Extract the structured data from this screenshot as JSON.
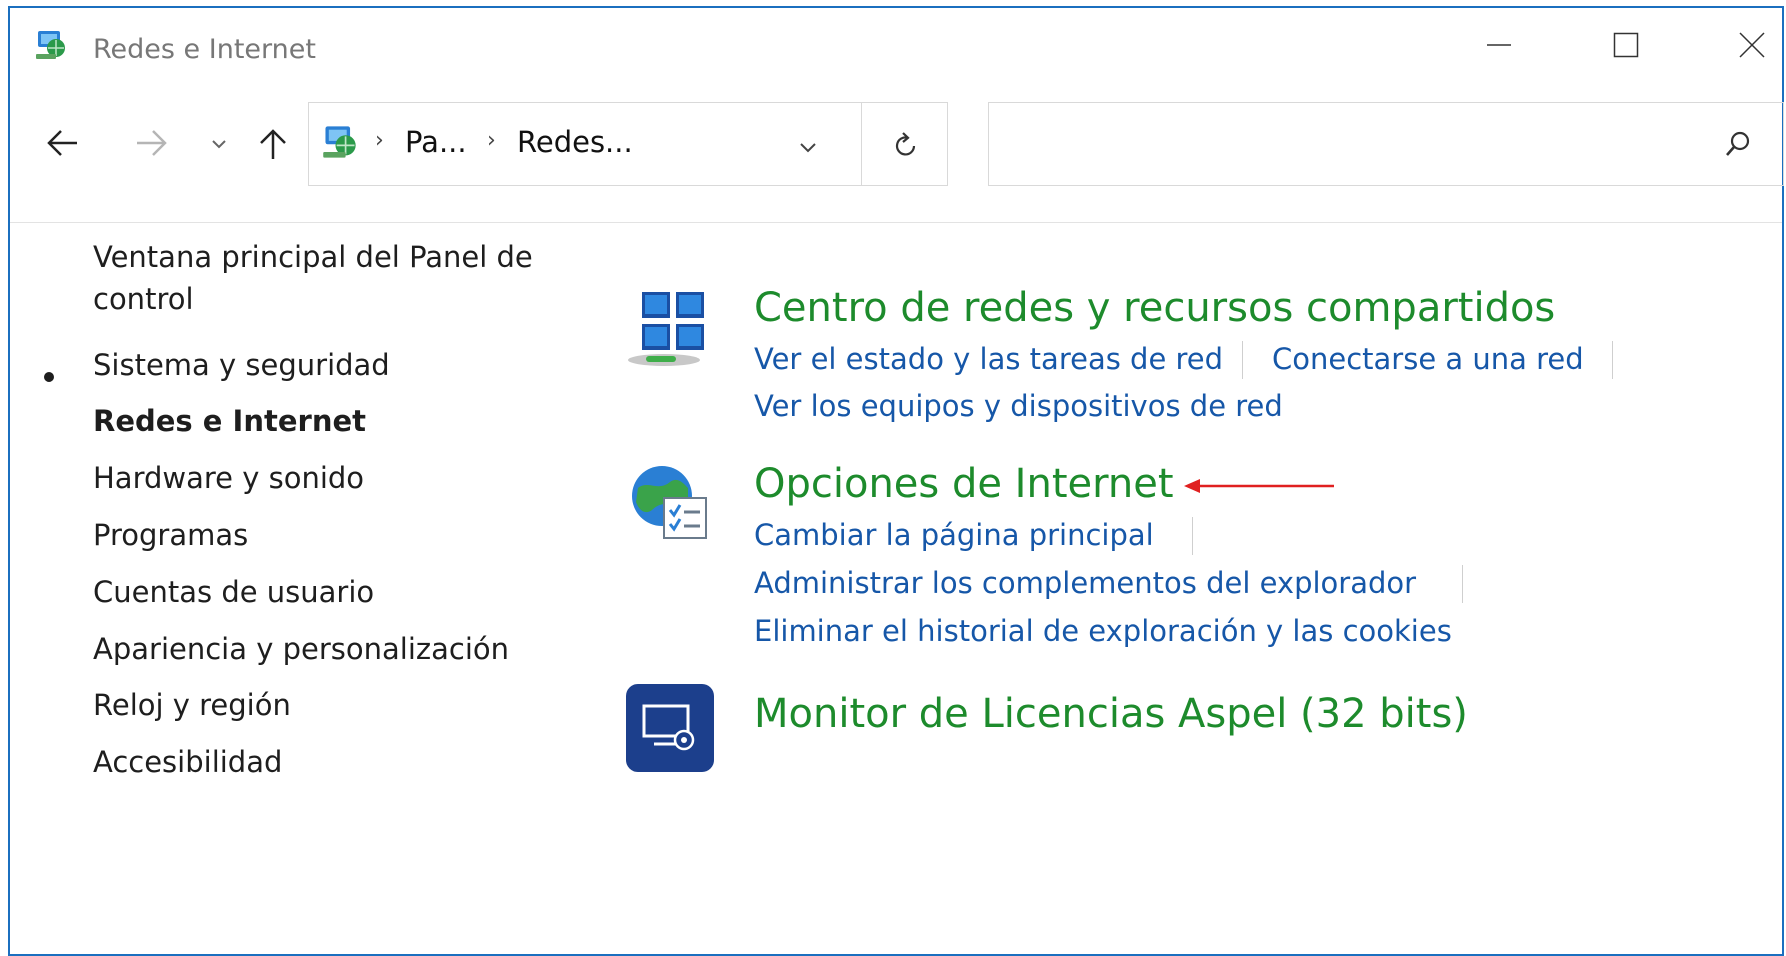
{
  "window": {
    "title": "Redes e Internet",
    "title_icon": "network-globe-icon",
    "controls": {
      "minimize": "minimize-icon",
      "maximize": "maximize-icon",
      "close": "close-icon"
    }
  },
  "navigation": {
    "back_icon": "arrow-left-icon",
    "forward_icon": "arrow-right-icon",
    "recent_icon": "chevron-down-icon",
    "up_icon": "arrow-up-icon",
    "address": {
      "crumbs": [
        "Pa...",
        "Redes..."
      ],
      "refresh_icon": "refresh-icon"
    },
    "search": {
      "value": "",
      "placeholder": "",
      "icon": "search-icon"
    }
  },
  "sidebar": {
    "items": [
      {
        "label": "Ventana principal del Panel de",
        "label2": "control"
      },
      {
        "label": "Sistema y seguridad"
      },
      {
        "label": "Redes e Internet",
        "current": true
      },
      {
        "label": "Hardware y sonido"
      },
      {
        "label": "Programas"
      },
      {
        "label": "Cuentas de usuario"
      },
      {
        "label": "Apariencia y personalización"
      },
      {
        "label": "Reloj y región"
      },
      {
        "label": "Accesibilidad"
      }
    ]
  },
  "categories": [
    {
      "title": "Centro de redes y recursos compartidos",
      "icon": "network-center-icon",
      "links": [
        "Ver el estado y las tareas de red",
        "Conectarse a una red",
        "Ver los equipos y dispositivos de red"
      ]
    },
    {
      "title": "Opciones de Internet",
      "icon": "internet-options-icon",
      "links": [
        "Cambiar la página principal",
        "Administrar los complementos del explorador",
        "Eliminar el historial de exploración y las cookies"
      ]
    },
    {
      "title": "Monitor de Licencias Aspel (32 bits)",
      "icon": "license-monitor-icon",
      "links": []
    }
  ],
  "annotation": {
    "arrow_icon": "red-arrow-icon",
    "color": "#e02020"
  },
  "colors": {
    "category_title": "#1d8b2c",
    "link": "#1657a8",
    "window_border": "#1b6fbf"
  }
}
